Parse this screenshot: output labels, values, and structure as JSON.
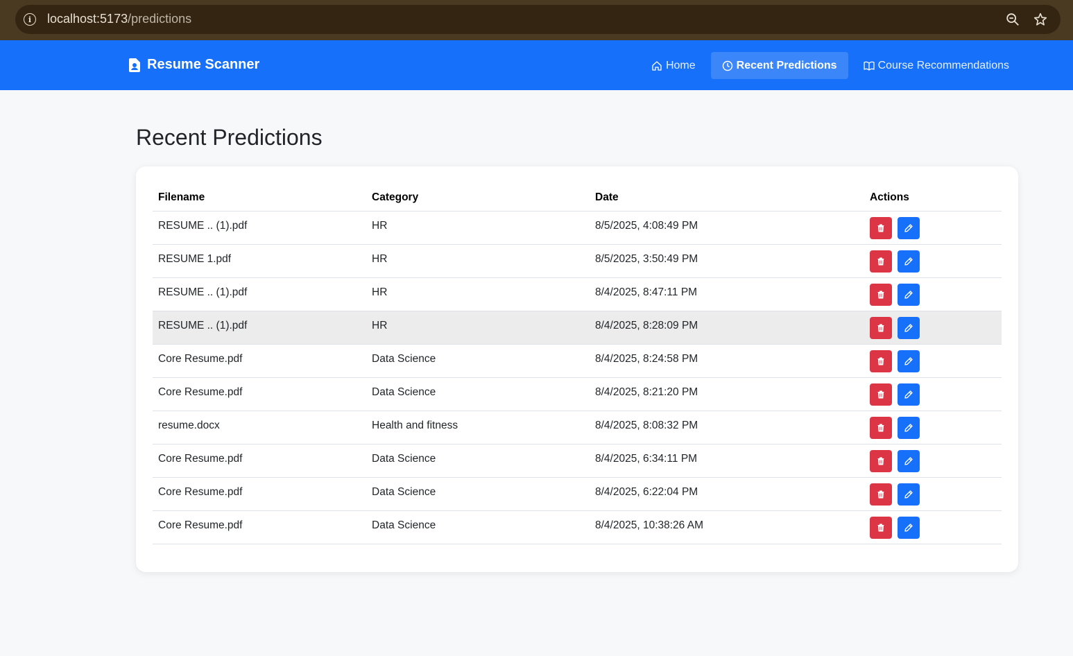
{
  "browser": {
    "url_host": "localhost:5173",
    "url_path": "/predictions"
  },
  "navbar": {
    "brand": "Resume Scanner",
    "items": [
      {
        "label": "Home",
        "icon": "home-icon",
        "active": false
      },
      {
        "label": "Recent Predictions",
        "icon": "clock-icon",
        "active": true
      },
      {
        "label": "Course Recommendations",
        "icon": "book-icon",
        "active": false
      }
    ]
  },
  "page": {
    "title": "Recent Predictions"
  },
  "table": {
    "headers": {
      "filename": "Filename",
      "category": "Category",
      "date": "Date",
      "actions": "Actions"
    },
    "rows": [
      {
        "filename": "RESUME .. (1).pdf",
        "category": "HR",
        "date": "8/5/2025, 4:08:49 PM"
      },
      {
        "filename": "RESUME 1.pdf",
        "category": "HR",
        "date": "8/5/2025, 3:50:49 PM"
      },
      {
        "filename": "RESUME .. (1).pdf",
        "category": "HR",
        "date": "8/4/2025, 8:47:11 PM"
      },
      {
        "filename": "RESUME .. (1).pdf",
        "category": "HR",
        "date": "8/4/2025, 8:28:09 PM"
      },
      {
        "filename": "Core Resume.pdf",
        "category": "Data Science",
        "date": "8/4/2025, 8:24:58 PM"
      },
      {
        "filename": "Core Resume.pdf",
        "category": "Data Science",
        "date": "8/4/2025, 8:21:20 PM"
      },
      {
        "filename": "resume.docx",
        "category": "Health and fitness",
        "date": "8/4/2025, 8:08:32 PM"
      },
      {
        "filename": "Core Resume.pdf",
        "category": "Data Science",
        "date": "8/4/2025, 6:34:11 PM"
      },
      {
        "filename": "Core Resume.pdf",
        "category": "Data Science",
        "date": "8/4/2025, 6:22:04 PM"
      },
      {
        "filename": "Core Resume.pdf",
        "category": "Data Science",
        "date": "8/4/2025, 10:38:26 AM"
      }
    ]
  },
  "colors": {
    "primary": "#1670fa",
    "danger": "#dc3545"
  }
}
